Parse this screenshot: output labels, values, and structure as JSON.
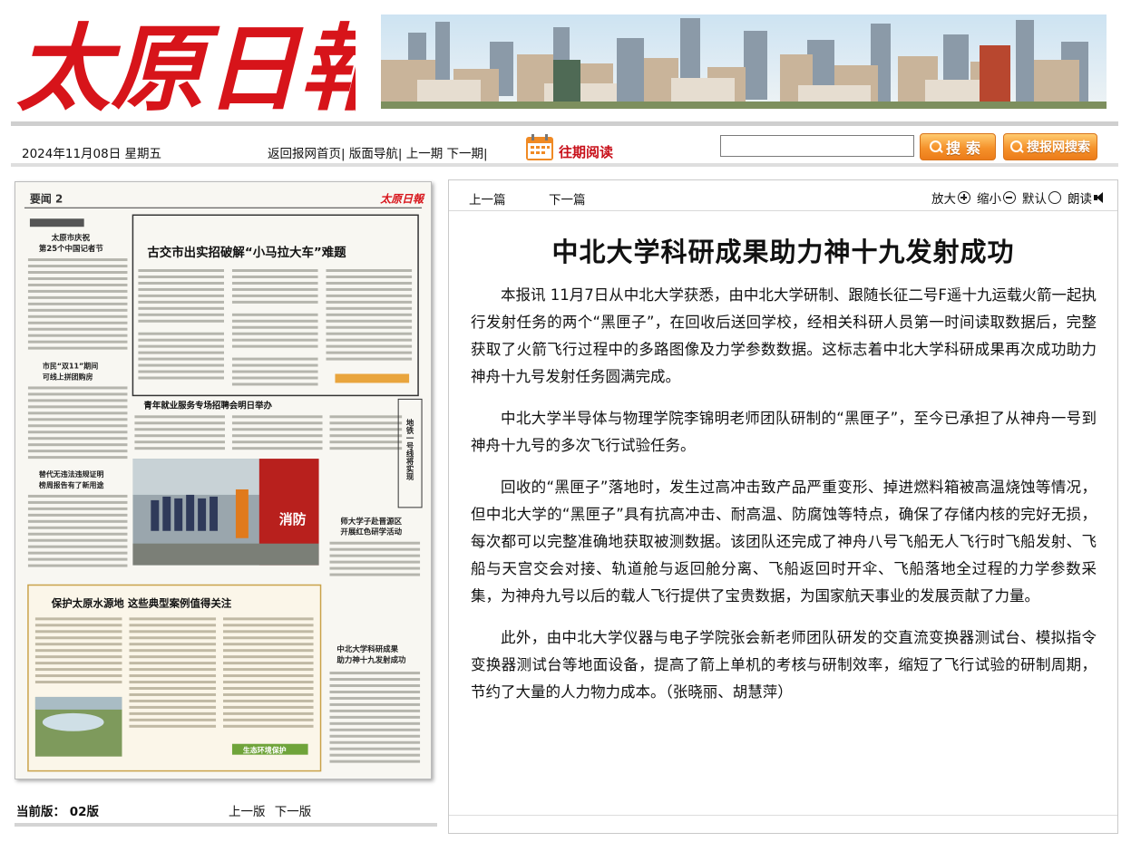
{
  "masthead": {
    "logo_text": "太原日報"
  },
  "toolbar": {
    "date": "2024年11月08日 星期五",
    "nav": [
      "返回报网首页|",
      "版面导航|",
      "上一期",
      "下一期|"
    ],
    "archive_label": "往期阅读",
    "search_value": "",
    "search_button": "搜索",
    "site_search_button": "搜报网搜索"
  },
  "paper": {
    "page_label": "要闻 2",
    "page_logo": "太原日報",
    "headlines": {
      "main": "古交市出实招破解“小马拉大车”难题",
      "left1": "太原市庆祝",
      "left1b": "第25个中国记者节",
      "left2": "市民“双11”期间",
      "left2b": "可线上拼团购房",
      "left3": "替代无违法违规证明",
      "left3b": "榜周报告有了新用途",
      "jobs": "青年就业服务专场招聘会明日举办",
      "vertical": "地铁一号线将实现",
      "teachers": "师大学子赴晋源区",
      "teachers2": "开展红色研学活动",
      "water": "保护太原水源地  这些典型案例值得关注",
      "cnu": "中北大学科研成果",
      "cnu2": "助力神十九发射成功",
      "eco": "生态环境保护"
    },
    "edition_label": "当前版：",
    "edition_value": "02版",
    "prev_edition": "上一版",
    "next_edition": "下一版"
  },
  "article": {
    "prev": "上一篇",
    "next": "下一篇",
    "zoom_in": "放大",
    "zoom_out": "缩小",
    "default": "默认",
    "read_aloud": "朗读",
    "title": "中北大学科研成果助力神十九发射成功",
    "paragraphs": [
      "本报讯 11月7日从中北大学获悉，由中北大学研制、跟随长征二号F遥十九运载火箭一起执行发射任务的两个“黑匣子”，在回收后送回学校，经相关科研人员第一时间读取数据后，完整获取了火箭飞行过程中的多路图像及力学参数数据。这标志着中北大学科研成果再次成功助力神舟十九号发射任务圆满完成。",
      "中北大学半导体与物理学院李锦明老师团队研制的“黑匣子”，至今已承担了从神舟一号到神舟十九号的多次飞行试验任务。",
      "回收的“黑匣子”落地时，发生过高冲击致产品严重变形、掉进燃料箱被高温烧蚀等情况，但中北大学的“黑匣子”具有抗高冲击、耐高温、防腐蚀等特点，确保了存储内核的完好无损，每次都可以完整准确地获取被测数据。该团队还完成了神舟八号飞船无人飞行时飞船发射、飞船与天宫交会对接、轨道舱与返回舱分离、飞船返回时开伞、飞船落地全过程的力学参数采集，为神舟九号以后的载人飞行提供了宝贵数据，为国家航天事业的发展贡献了力量。",
      "此外，由中北大学仪器与电子学院张会新老师团队研发的交直流变换器测试台、模拟指令变换器测试台等地面设备，提高了箭上单机的考核与研制效率，缩短了飞行试验的研制周期，节约了大量的人力物力成本。（张晓丽、胡慧萍）"
    ]
  }
}
